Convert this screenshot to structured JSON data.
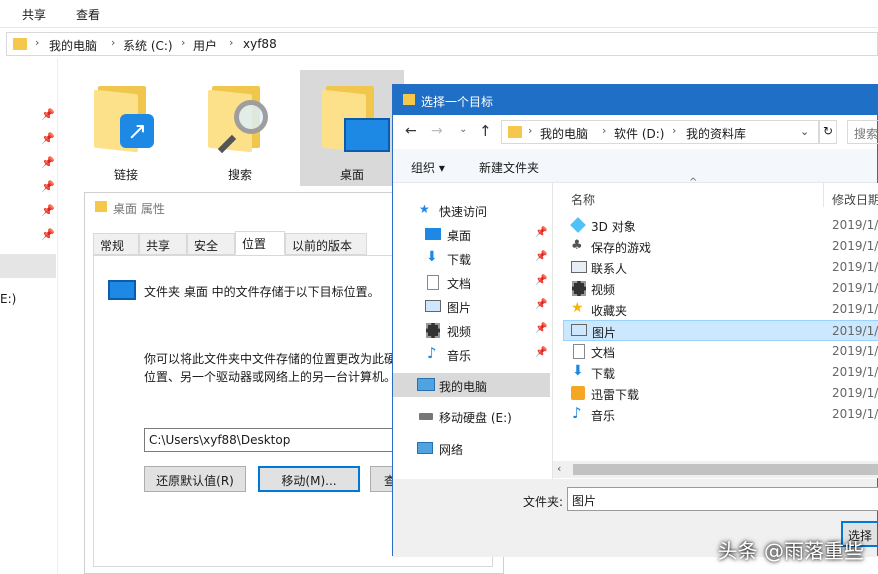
{
  "ribbon": {
    "tabs": [
      "共享",
      "查看"
    ]
  },
  "explorer": {
    "breadcrumb": [
      "我的电脑",
      "系统 (C:)",
      "用户",
      "xyf88"
    ],
    "left_pane_partial": "E:)",
    "folders": [
      "链接",
      "搜索",
      "桌面"
    ]
  },
  "properties": {
    "title": "桌面 属性",
    "tabs": [
      "常规",
      "共享",
      "安全",
      "位置",
      "以前的版本"
    ],
    "active_tab": "位置",
    "desc1": "文件夹 桌面 中的文件存储于以下目标位置。",
    "desc2_line1": "你可以将此文件夹中文件存储的位置更改为此硬",
    "desc2_line2": "位置、另一个驱动器或网络上的另一台计算机。",
    "path_value": "C:\\Users\\xyf88\\Desktop",
    "btn_restore": "还原默认值(R)",
    "btn_move": "移动(M)...",
    "btn_find_partial": "查"
  },
  "select_dialog": {
    "title": "选择一个目标",
    "breadcrumb": [
      "我的电脑",
      "软件 (D:)",
      "我的资料库"
    ],
    "search_placeholder": "搜索",
    "toolbar": {
      "organize": "组织",
      "new_folder": "新建文件夹"
    },
    "nav": [
      {
        "label": "快速访问",
        "icon": "star"
      },
      {
        "label": "桌面",
        "icon": "desktop",
        "pinned": true
      },
      {
        "label": "下载",
        "icon": "download",
        "pinned": true
      },
      {
        "label": "文档",
        "icon": "document",
        "pinned": true
      },
      {
        "label": "图片",
        "icon": "picture",
        "pinned": true
      },
      {
        "label": "视频",
        "icon": "video",
        "pinned": true
      },
      {
        "label": "音乐",
        "icon": "music",
        "pinned": true
      },
      {
        "label": "我的电脑",
        "icon": "computer",
        "active": true
      },
      {
        "label": "移动硬盘 (E:)",
        "icon": "drive"
      },
      {
        "label": "网络",
        "icon": "network"
      }
    ],
    "columns": {
      "name": "名称",
      "modified": "修改日期"
    },
    "rows": [
      {
        "name": "3D 对象",
        "date": "2019/1/",
        "icon": "cube"
      },
      {
        "name": "保存的游戏",
        "date": "2019/1/",
        "icon": "game"
      },
      {
        "name": "联系人",
        "date": "2019/1/",
        "icon": "contacts"
      },
      {
        "name": "视频",
        "date": "2019/1/",
        "icon": "video"
      },
      {
        "name": "收藏夹",
        "date": "2019/1/",
        "icon": "star"
      },
      {
        "name": "图片",
        "date": "2019/1/",
        "icon": "picture",
        "selected": true
      },
      {
        "name": "文档",
        "date": "2019/1/",
        "icon": "document"
      },
      {
        "name": "下载",
        "date": "2019/1/",
        "icon": "download"
      },
      {
        "name": "迅雷下载",
        "date": "2019/1/",
        "icon": "thunder"
      },
      {
        "name": "音乐",
        "date": "2019/1/",
        "icon": "music"
      }
    ],
    "folder_label": "文件夹:",
    "folder_value": "图片",
    "btn_select_partial": "选择"
  },
  "watermark": "头条 @雨落重些",
  "colors": {
    "accent": "#0078d7",
    "titlebar": "#1f6fc6",
    "selection": "#cce8ff",
    "folder": "#fde18a"
  }
}
